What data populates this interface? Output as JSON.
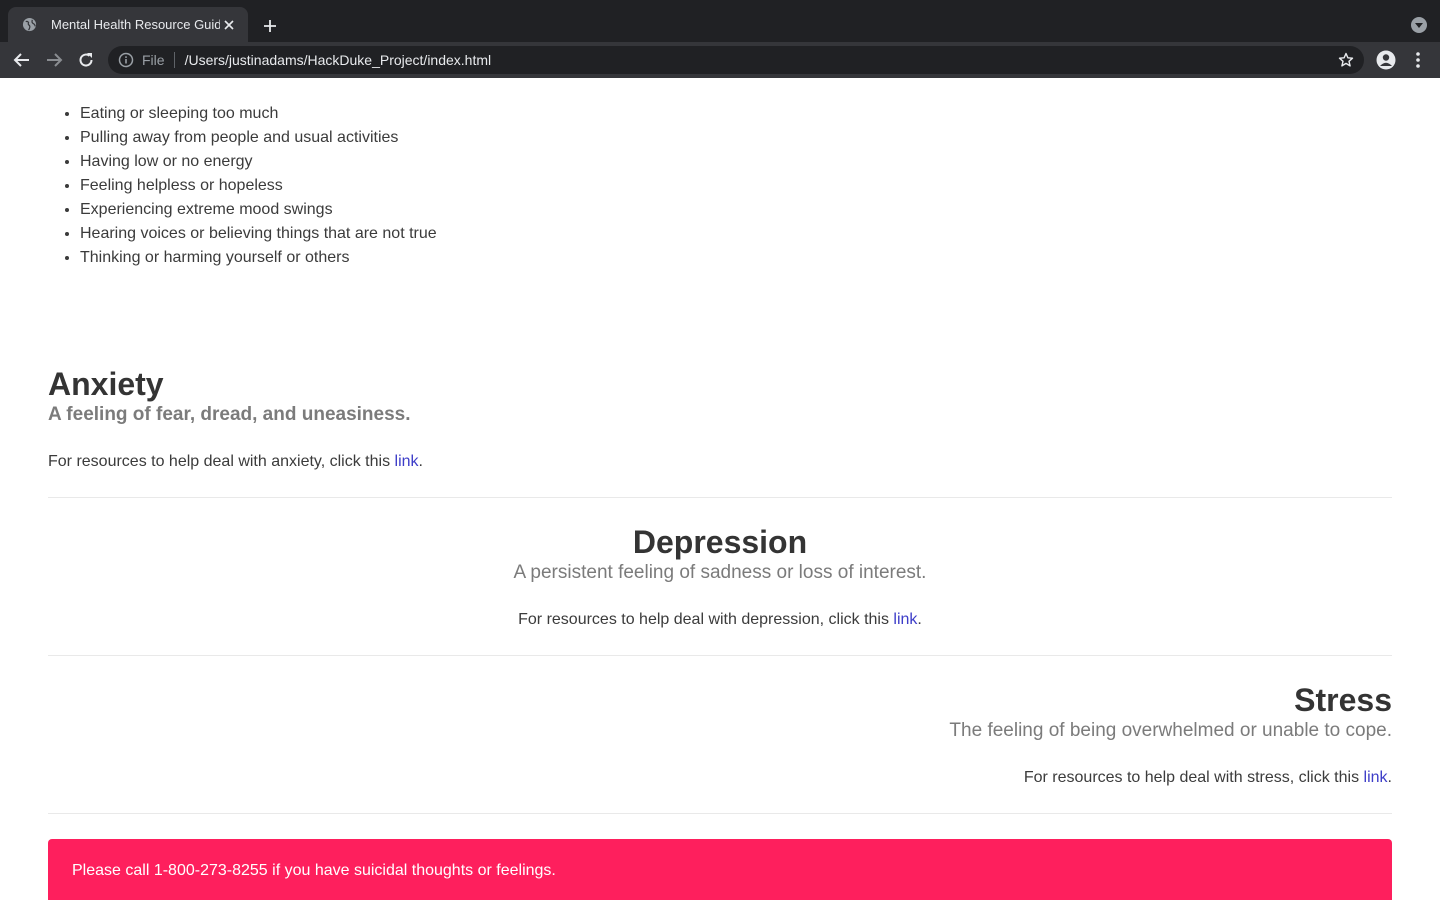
{
  "browser": {
    "tab_title": "Mental Health Resource Guide",
    "url_scheme": "File",
    "url": "/Users/justinadams/HackDuke_Project/index.html"
  },
  "warning_signs": [
    "Eating or sleeping too much",
    "Pulling away from people and usual activities",
    "Having low or no energy",
    "Feeling helpless or hopeless",
    "Experiencing extreme mood swings",
    "Hearing voices or believing things that are not true",
    "Thinking or harming yourself or others"
  ],
  "sections": {
    "anxiety": {
      "title": "Anxiety",
      "subtitle": "A feeling of fear, dread, and uneasiness.",
      "text": "For resources to help deal with anxiety, click this ",
      "link": "link",
      "after": "."
    },
    "depression": {
      "title": "Depression",
      "subtitle": "A persistent feeling of sadness or loss of interest.",
      "text": "For resources to help deal with depression, click this ",
      "link": "link",
      "after": "."
    },
    "stress": {
      "title": "Stress",
      "subtitle": "The feeling of being overwhelmed or unable to cope.",
      "text": "For resources to help deal with stress, click this ",
      "link": "link",
      "after": "."
    }
  },
  "alert": {
    "text": "Please call 1-800-273-8255 if you have suicidal thoughts or feelings."
  },
  "colors": {
    "chrome_dark": "#202124",
    "chrome_toolbar": "#35363a",
    "link": "#3d3dc8",
    "alert_bg": "#fe1f5d"
  }
}
